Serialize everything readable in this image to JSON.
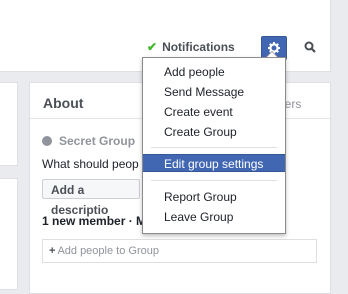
{
  "header": {
    "notifications_label": "Notifications",
    "gear_icon": "gear-icon",
    "search_icon": "search-icon"
  },
  "dropdown": {
    "items_group1": [
      "Add people",
      "Send Message",
      "Create event",
      "Create Group"
    ],
    "active_item": "Edit group settings",
    "items_group3": [
      "Report Group",
      "Leave Group"
    ]
  },
  "about": {
    "title": "About",
    "members_link": "mbers",
    "privacy": "Secret Group",
    "description_prompt": "What should peop",
    "add_description_button": "Add a descriptio",
    "new_member_text": "1 new member · M",
    "add_people_placeholder": "Add people to Group"
  },
  "colors": {
    "accent": "#4267b2",
    "check": "#42b72a",
    "muted": "#90949c"
  }
}
